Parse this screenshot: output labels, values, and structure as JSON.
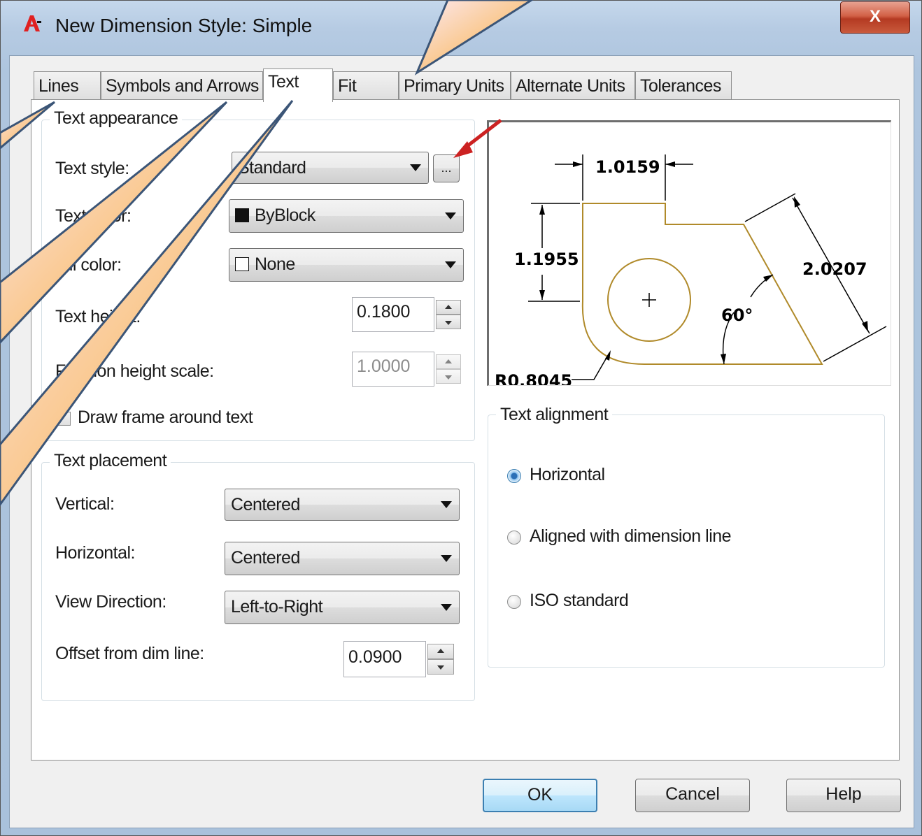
{
  "window": {
    "title": "New Dimension Style: Simple",
    "close_label": "X"
  },
  "tabs": [
    {
      "label": "Lines",
      "active": false
    },
    {
      "label": "Symbols and Arrows",
      "active": false
    },
    {
      "label": "Text",
      "active": true
    },
    {
      "label": "Fit",
      "active": false
    },
    {
      "label": "Primary Units",
      "active": false
    },
    {
      "label": "Alternate Units",
      "active": false
    },
    {
      "label": "Tolerances",
      "active": false
    }
  ],
  "appearance": {
    "title": "Text appearance",
    "text_style_label": "Text style:",
    "text_style_value": "Standard",
    "browse_label": "...",
    "text_color_label": "Text color:",
    "text_color_value": "ByBlock",
    "text_color_swatch": "#111111",
    "fill_color_label": "Fill color:",
    "fill_color_value": "None",
    "fill_color_swatch": "#ffffff",
    "text_height_label": "Text height:",
    "text_height_value": "0.1800",
    "fraction_label": "Fraction height scale:",
    "fraction_value": "1.0000",
    "frame_label": "Draw frame around text",
    "frame_checked": false
  },
  "placement": {
    "title": "Text placement",
    "vertical_label": "Vertical:",
    "vertical_value": "Centered",
    "horizontal_label": "Horizontal:",
    "horizontal_value": "Centered",
    "view_label": "View Direction:",
    "view_value": "Left-to-Right",
    "offset_label": "Offset from dim line:",
    "offset_value": "0.0900"
  },
  "preview": {
    "dim_top": "1.0159",
    "dim_left": "1.1955",
    "dim_right": "2.0207",
    "angle": "60°",
    "radius": "R0.8045",
    "outline_color": "#b08a2a"
  },
  "alignment": {
    "title": "Text alignment",
    "options": [
      {
        "label": "Horizontal",
        "selected": true
      },
      {
        "label": "Aligned with dimension line",
        "selected": false
      },
      {
        "label": "ISO standard",
        "selected": false
      }
    ]
  },
  "buttons": {
    "ok": "OK",
    "cancel": "Cancel",
    "help": "Help"
  },
  "colors": {
    "callout_fill": "#f7b468",
    "callout_stroke": "#3b5577",
    "callout_highlight": "#fdf0f5",
    "red_arrow": "#cc2222",
    "title_gradient_top": "#c5d8ec",
    "close_button": "#c94a30"
  }
}
